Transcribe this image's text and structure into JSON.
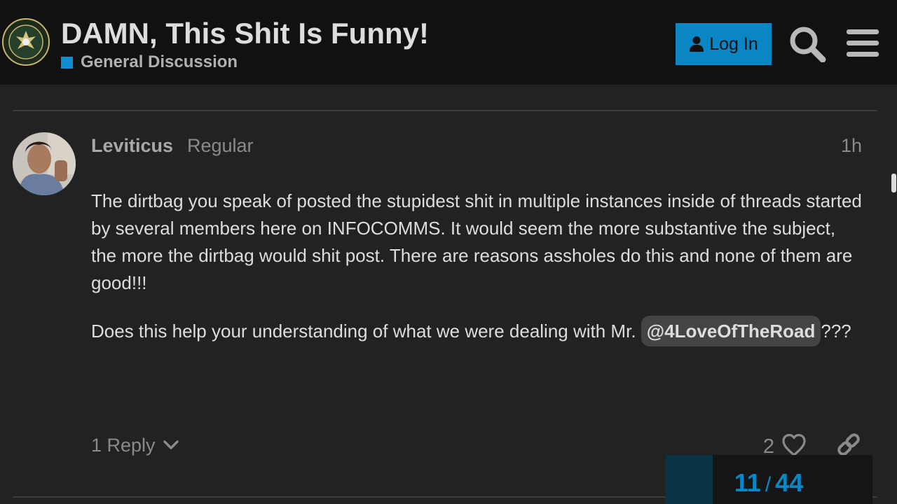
{
  "header": {
    "topic_title": "DAMN, This Shit Is Funny!",
    "category_name": "General Discussion",
    "category_color": "#0f8fd2",
    "login_label": "Log In",
    "login_color": "#0a86c4",
    "logo_icon": "army-seal-logo",
    "search_icon": "search-icon",
    "menu_icon": "hamburger-menu-icon"
  },
  "post": {
    "username": "Leviticus",
    "user_title": "Regular",
    "date": "1h",
    "paragraph_1": "The dirtbag you speak of posted the stupidest shit in multiple instances inside of threads started by several members here on INFOCOMMS. It would seem the more substantive the subject, the more the dirtbag would shit post. There are reasons assholes do this and none of them are good!!!",
    "paragraph_2_text": "Does this help your understanding of what we were dealing with Mr.",
    "mention": "@4LoveOfTheRoad",
    "paragraph_2_suffix": "???",
    "replies_label": "1 Reply",
    "like_count": "2"
  },
  "timeline": {
    "current": "11",
    "separator": "/",
    "total": "44"
  }
}
